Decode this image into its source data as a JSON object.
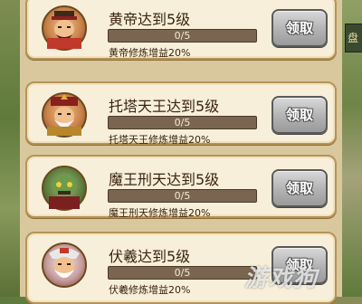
{
  "side_tab": {
    "label": "盘"
  },
  "tasks": [
    {
      "title": "黄帝达到5级",
      "progress": "0/5",
      "progress_fraction": 0,
      "description": "黄帝修炼增益20%",
      "button": "领取",
      "avatar_icon": "huangdi-portrait-icon"
    },
    {
      "title": "托塔天王达到5级",
      "progress": "0/5",
      "progress_fraction": 0,
      "description": "托塔天王修炼增益20%",
      "button": "领取",
      "avatar_icon": "tuotatianwang-portrait-icon"
    },
    {
      "title": "魔王刑天达到5级",
      "progress": "0/5",
      "progress_fraction": 0,
      "description": "魔王刑天修炼增益20%",
      "button": "领取",
      "avatar_icon": "xingtian-portrait-icon"
    },
    {
      "title": "伏羲达到5级",
      "progress": "0/5",
      "progress_fraction": 0,
      "description": "伏羲修炼增益20%",
      "button": "领取",
      "avatar_icon": "fuxi-portrait-icon"
    }
  ],
  "watermark": "游戏狗",
  "colors": {
    "card_bg": "#f7efd9",
    "card_border": "#b79356",
    "button_gray": "#b5b5b5",
    "bar_bg": "#7a6650"
  }
}
